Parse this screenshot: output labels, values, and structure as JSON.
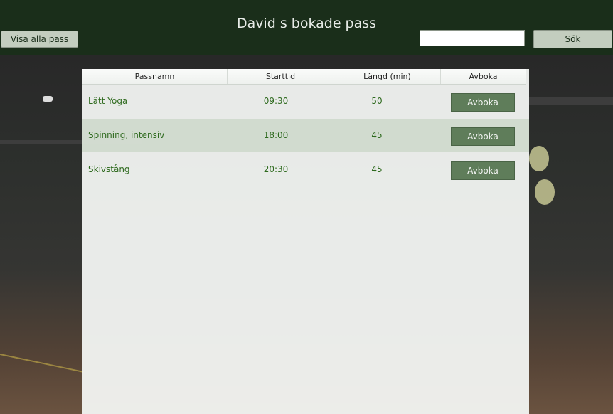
{
  "header": {
    "title": "David s bokade pass",
    "show_all_label": "Visa alla pass",
    "search_value": "",
    "search_button_label": "Sök"
  },
  "table": {
    "columns": [
      "Passnamn",
      "Starttid",
      "Längd (min)",
      "Avboka"
    ],
    "rows": [
      {
        "name": "Lätt Yoga",
        "start": "09:30",
        "length": "50",
        "action": "Avboka"
      },
      {
        "name": "Spinning, intensiv",
        "start": "18:00",
        "length": "45",
        "action": "Avboka"
      },
      {
        "name": "Skivstång",
        "start": "20:30",
        "length": "45",
        "action": "Avboka"
      }
    ]
  },
  "colors": {
    "header_bg": "#1a2e1a",
    "row_text": "#2e6a1e",
    "cancel_button": "#5f7d5a",
    "light_button": "#c3cdbf"
  }
}
